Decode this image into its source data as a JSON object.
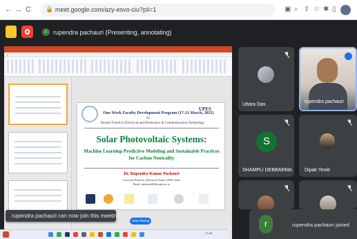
{
  "browser": {
    "url": "meet.google.com/azy-esvo-ciu?pli=1",
    "nav": {
      "back": "←",
      "forward": "→",
      "reload": "C"
    },
    "right_icons": [
      "cast-icon",
      "search-icon",
      "share-icon",
      "star-icon",
      "extension-icon",
      "sidebar-icon"
    ]
  },
  "meet": {
    "presenter_initial": "r",
    "presenter_banner": "rupendra pachauri (Presenting, annotating)"
  },
  "slide": {
    "program": "One-Week Faculty Development Program (17-21 March, 2025)",
    "on": "on",
    "topic": "Recent Trends in Electrical and Electronics & Communication Technology",
    "brand": "UPES",
    "heading": "Solar Photovoltaic Systems:",
    "subheading_1": "Machine Learning-Predictive Modeling and  Sustainable Practices",
    "subheading_2": "for Carbon Neutrality",
    "speaker": "Dr. Rupendra Kumar Pachauri",
    "speaker_line_2": "Associate Professor, Electrical Cluster, UPES, India",
    "speaker_line_3": "Email: rpachauri@ddn.upes.ac.in",
    "slideshow_label": "Stop sharing"
  },
  "toast": {
    "text": "rupendra pachauri can now join this meeting"
  },
  "participants": [
    {
      "name": "Uttara Das",
      "type": "photo"
    },
    {
      "name": "rupendra pachauri",
      "type": "video"
    },
    {
      "name": "SHAMPLI DEBBARMA",
      "type": "initial",
      "initial": "S",
      "color": "#137333"
    },
    {
      "name": "Dipak Yeole",
      "type": "photo"
    }
  ],
  "joined": {
    "initial": "r",
    "text": "rupendra pachauri joined"
  },
  "taskbar": {
    "time": "17:48"
  },
  "colors": {
    "meet_bg": "#202124",
    "tile_bg": "#3c4043",
    "accent": "#1a73e8",
    "slide_green": "#0c7f3c"
  }
}
